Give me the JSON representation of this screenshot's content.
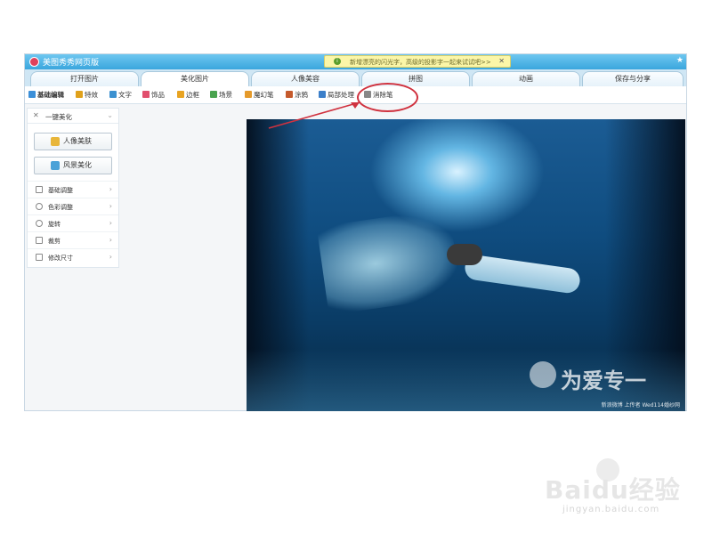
{
  "window": {
    "title": "美图秀秀网页版",
    "notice": "新增漂亮的闪光字，高级的投影字一起来试试吧>>",
    "notice_close": "✕"
  },
  "tabs": [
    {
      "label": "打开图片"
    },
    {
      "label": "美化图片"
    },
    {
      "label": "人像美容"
    },
    {
      "label": "拼图"
    },
    {
      "label": "动画"
    },
    {
      "label": "保存与分享"
    }
  ],
  "toolbar": {
    "items": [
      {
        "label": "基础编辑",
        "icon": "image-icon",
        "color": "#3b8fd8"
      },
      {
        "label": "特效",
        "icon": "magic-icon",
        "color": "#e0a11b"
      },
      {
        "label": "文字",
        "icon": "text-icon",
        "color": "#3c91d0"
      },
      {
        "label": "饰品",
        "icon": "bow-icon",
        "color": "#e14f6d"
      },
      {
        "label": "边框",
        "icon": "frame-icon",
        "color": "#e8a321"
      },
      {
        "label": "场景",
        "icon": "scene-icon",
        "color": "#49a34f"
      },
      {
        "label": "魔幻笔",
        "icon": "magic-pen-icon",
        "color": "#e59a2b"
      },
      {
        "label": "涂鸦",
        "icon": "doodle-icon",
        "color": "#c55a2c"
      },
      {
        "label": "局部处理",
        "icon": "brush-icon",
        "color": "#3c7fc9"
      },
      {
        "label": "消除笔",
        "icon": "eraser-icon",
        "color": "#888888"
      }
    ]
  },
  "panel": {
    "header": "一键美化",
    "buttons": [
      {
        "label": "人像美肤",
        "icon": "portrait-icon",
        "color": "#e8b63a"
      },
      {
        "label": "风景美化",
        "icon": "landscape-icon",
        "color": "#4aa2d8"
      }
    ],
    "menu": [
      {
        "label": "基础调整"
      },
      {
        "label": "色彩调整"
      },
      {
        "label": "旋转"
      },
      {
        "label": "裁剪"
      },
      {
        "label": "修改尺寸"
      }
    ]
  },
  "photo": {
    "watermark": "为爱专一",
    "credit": "新浪微博 上传者 Wed114婚纱网"
  },
  "annotation": {
    "color": "#d0323f",
    "highlight_target": "消除笔"
  },
  "site_watermark": {
    "main": "Baidu经验",
    "sub": "jingyan.baidu.com"
  }
}
